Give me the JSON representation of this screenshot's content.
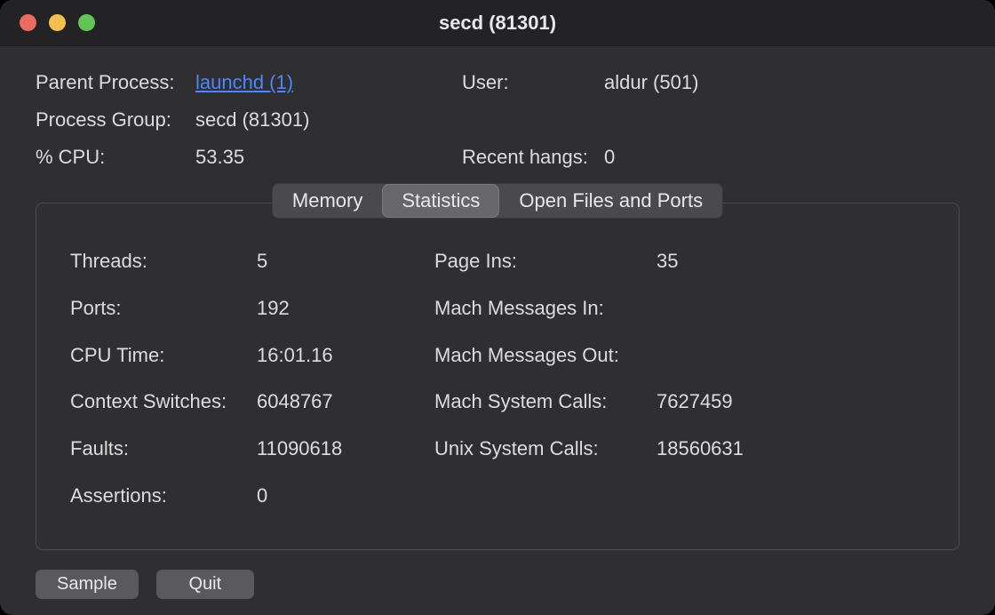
{
  "window": {
    "title": "secd (81301)"
  },
  "header": {
    "parentProcess": {
      "label": "Parent Process:",
      "value": "launchd (1)"
    },
    "user": {
      "label": "User:",
      "value": "aldur (501)"
    },
    "processGroup": {
      "label": "Process Group:",
      "value": "secd (81301)"
    },
    "cpu": {
      "label": "% CPU:",
      "value": "53.35"
    },
    "recentHangs": {
      "label": "Recent hangs:",
      "value": "0"
    }
  },
  "tabs": {
    "memory": "Memory",
    "statistics": "Statistics",
    "openFiles": "Open Files and Ports",
    "selected": "statistics"
  },
  "stats": {
    "left": [
      {
        "label": "Threads:",
        "value": "5"
      },
      {
        "label": "Ports:",
        "value": "192"
      },
      {
        "label": "CPU Time:",
        "value": "16:01.16"
      },
      {
        "label": "Context Switches:",
        "value": "6048767"
      },
      {
        "label": "Faults:",
        "value": "11090618"
      },
      {
        "label": "Assertions:",
        "value": "0"
      }
    ],
    "right": [
      {
        "label": "Page Ins:",
        "value": "35"
      },
      {
        "label": "Mach Messages In:",
        "value": ""
      },
      {
        "label": "Mach Messages Out:",
        "value": ""
      },
      {
        "label": "Mach System Calls:",
        "value": "7627459"
      },
      {
        "label": "Unix System Calls:",
        "value": "18560631"
      },
      {
        "label": "",
        "value": ""
      }
    ]
  },
  "footer": {
    "sample": "Sample",
    "quit": "Quit"
  }
}
